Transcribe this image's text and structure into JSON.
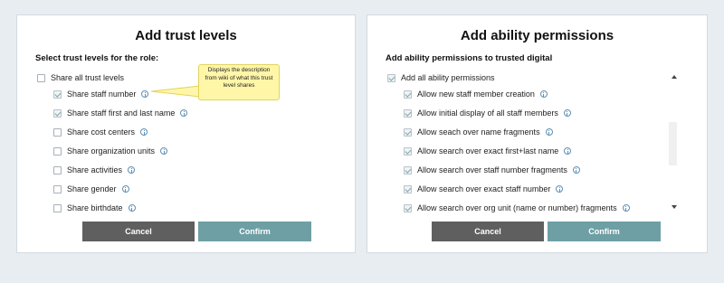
{
  "left": {
    "title": "Add trust levels",
    "subtitle": "Select trust levels for the role:",
    "all_label": "Share all trust levels",
    "items": [
      {
        "label": "Share staff number",
        "checked": true
      },
      {
        "label": "Share staff first and last name",
        "checked": true
      },
      {
        "label": "Share cost centers",
        "checked": false
      },
      {
        "label": "Share organization units",
        "checked": false
      },
      {
        "label": "Share activities",
        "checked": false
      },
      {
        "label": "Share gender",
        "checked": false
      },
      {
        "label": "Share birthdate",
        "checked": false
      }
    ],
    "tooltip": "Displays the description from wiki of what this trust level shares",
    "cancel": "Cancel",
    "confirm": "Confirm"
  },
  "right": {
    "title": "Add ability permissions",
    "subtitle": "Add ability permissions to trusted digital",
    "all_label": "Add all ability permissions",
    "items": [
      {
        "label": "Allow new staff member creation",
        "checked": true
      },
      {
        "label": "Allow initial display of all staff members",
        "checked": true
      },
      {
        "label": "Allow seach over name fragments",
        "checked": true
      },
      {
        "label": "Allow search over exact first+last name",
        "checked": true
      },
      {
        "label": "Allow search over staff number fragments",
        "checked": true
      },
      {
        "label": "Allow search over exact staff number",
        "checked": true
      },
      {
        "label": "Allow search over org unit (name or number) fragments",
        "checked": true
      }
    ],
    "cancel": "Cancel",
    "confirm": "Confirm"
  },
  "colors": {
    "cancel_button": "#5f5f5f",
    "confirm_button": "#6d9fa5",
    "tooltip_bg": "#fff6a8",
    "info_icon": "#5f8fb3"
  }
}
